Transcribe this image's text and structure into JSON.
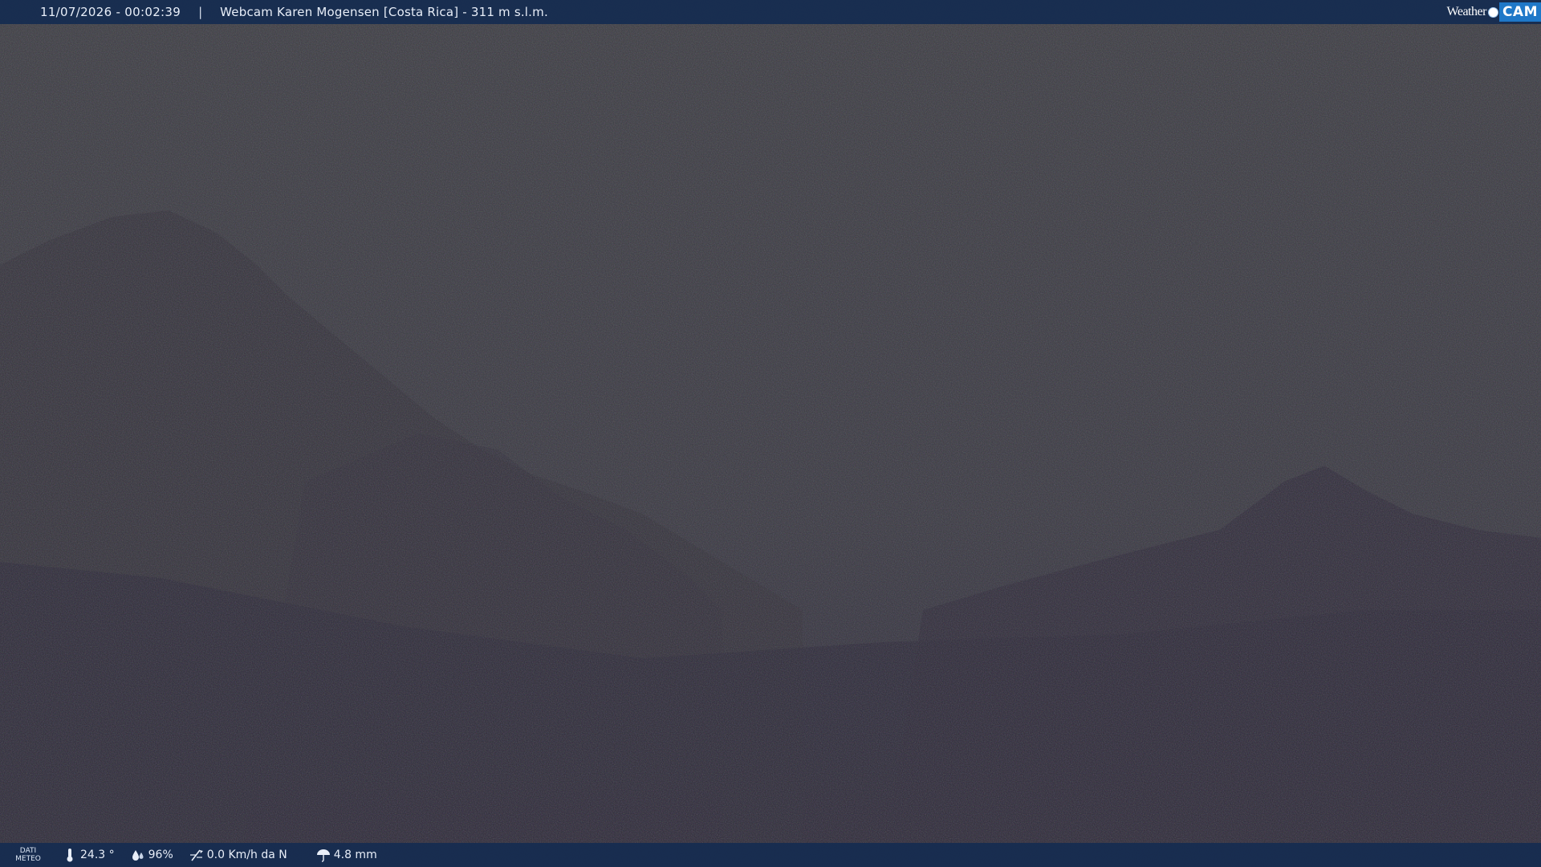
{
  "top_bar": {
    "timestamp": "11/07/2026 - 00:02:39",
    "separator": "|",
    "camera_title": "Webcam Karen Mogensen [Costa Rica]  - 311 m s.l.m."
  },
  "logo": {
    "part1": "Weather",
    "part2": "CAM"
  },
  "bottom_bar": {
    "meteo_label_line1": "DATI",
    "meteo_label_line2": "METEO",
    "temperature": "24.3 °",
    "humidity": "96%",
    "wind": "0.0 Km/h da N",
    "rain": "4.8 mm",
    "icons": {
      "temperature": "thermometer-icon",
      "humidity": "water-drops-icon",
      "wind": "wind-vane-icon",
      "rain": "umbrella-icon"
    }
  },
  "colors": {
    "bar_background": "#162c50",
    "bar_text": "#e8eef8",
    "logo_accent": "#1f78c8"
  }
}
